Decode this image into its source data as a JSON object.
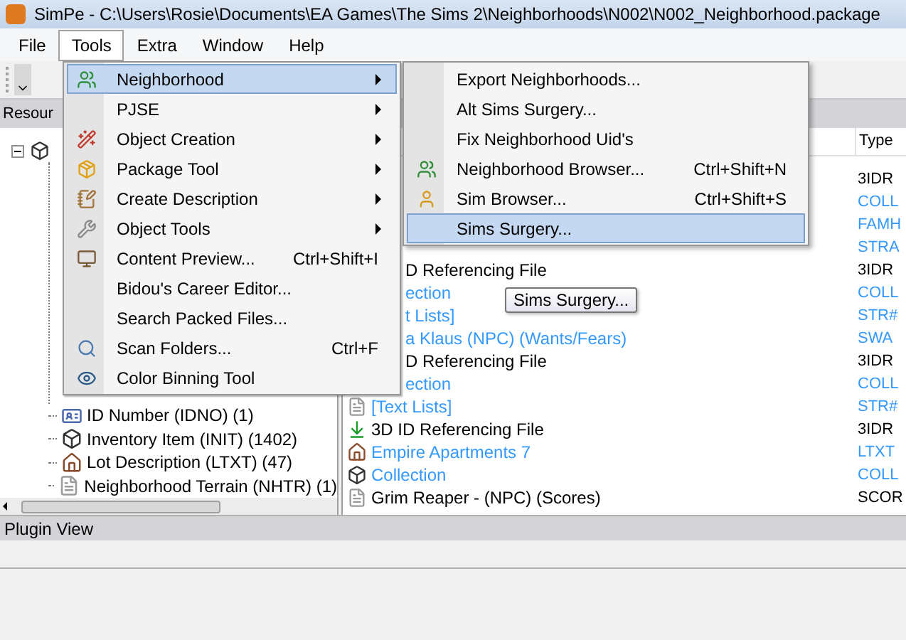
{
  "window": {
    "title": "SimPe - C:\\Users\\Rosie\\Documents\\EA Games\\The Sims 2\\Neighborhoods\\N002\\N002_Neighborhood.package"
  },
  "menu_bar": [
    {
      "label": "File",
      "selected": false
    },
    {
      "label": "Tools",
      "selected": true
    },
    {
      "label": "Extra",
      "selected": false
    },
    {
      "label": "Window",
      "selected": false
    },
    {
      "label": "Help",
      "selected": false
    }
  ],
  "resource_tree": {
    "header": "Resour",
    "root": {
      "expanded": true,
      "children": [
        {
          "label": "ID Number (IDNO) (1)",
          "kind": "id"
        },
        {
          "label": "Inventory Item (INIT) (1402)",
          "kind": "cube"
        },
        {
          "label": "Lot Description (LTXT) (47)",
          "kind": "house"
        },
        {
          "label": "Neighborhood Terrain (NHTR) (1)",
          "kind": "file"
        }
      ]
    }
  },
  "resource_list": {
    "columns": [
      "Type"
    ],
    "rows": [
      {
        "type": "3IDR",
        "color": "#000000"
      },
      {
        "type": "COLL",
        "color": "#3399ff"
      },
      {
        "type": "FAMH",
        "color": "#3399ff"
      },
      {
        "type": "STRA",
        "color": "#3399ff"
      },
      {
        "name": "D Referencing File",
        "type": "3IDR",
        "color": "#000000"
      },
      {
        "name": "ection",
        "type": "COLL",
        "color": "#3399ff"
      },
      {
        "name": "t Lists]",
        "type": "STR#",
        "color": "#3399ff"
      },
      {
        "name": "a Klaus (NPC) (Wants/Fears)",
        "type": "SWA",
        "color": "#3399ff"
      },
      {
        "name": "D Referencing File",
        "type": "3IDR",
        "color": "#000000"
      },
      {
        "name": "ection",
        "type": "COLL",
        "color": "#3399ff"
      },
      {
        "name": "[Text Lists]",
        "type": "STR#",
        "color": "#3399ff",
        "kind": "file"
      },
      {
        "name": "3D ID Referencing File",
        "type": "3IDR",
        "color": "#000000",
        "kind": "arrow"
      },
      {
        "name": "Empire Apartments 7",
        "type": "LTXT",
        "color": "#3399ff",
        "kind": "house"
      },
      {
        "name": "Collection",
        "type": "COLL",
        "color": "#3399ff",
        "kind": "cube"
      },
      {
        "name": "Grim Reaper - (NPC) (Scores)",
        "type": "SCOR",
        "color": "#000000",
        "kind": "file"
      }
    ]
  },
  "tools_menu": {
    "items": [
      {
        "label": "Neighborhood",
        "kind": "people",
        "submenu": true,
        "selected": true
      },
      {
        "label": "PJSE",
        "submenu": true,
        "selected": false
      },
      {
        "label": "Object Creation",
        "kind": "wand",
        "submenu": true,
        "selected": false
      },
      {
        "label": "Package Tool",
        "kind": "package",
        "submenu": true,
        "selected": false
      },
      {
        "label": "Create Description",
        "kind": "note",
        "submenu": true,
        "selected": false
      },
      {
        "label": "Object Tools",
        "kind": "wrench",
        "submenu": true,
        "selected": false
      },
      {
        "label": "Content Preview...",
        "shortcut": "Ctrl+Shift+I",
        "kind": "preview",
        "selected": false
      },
      {
        "label": "Bidou's Career Editor...",
        "selected": false
      },
      {
        "label": "Search Packed Files...",
        "selected": false
      },
      {
        "label": "Scan Folders...",
        "shortcut": "Ctrl+F",
        "kind": "search",
        "selected": false
      },
      {
        "label": "Color Binning Tool",
        "kind": "eye",
        "selected": false
      }
    ]
  },
  "neighborhood_submenu": {
    "items": [
      {
        "label": "Export Neighborhoods...",
        "selected": false
      },
      {
        "label": "Alt Sims Surgery...",
        "selected": false
      },
      {
        "label": "Fix Neighborhood Uid's",
        "selected": false
      },
      {
        "label": "Neighborhood Browser...",
        "shortcut": "Ctrl+Shift+N",
        "kind": "people",
        "selected": false
      },
      {
        "label": "Sim Browser...",
        "shortcut": "Ctrl+Shift+S",
        "kind": "person",
        "selected": false
      },
      {
        "label": "Sims Surgery...",
        "selected": true
      }
    ]
  },
  "tooltip": "Sims Surgery...",
  "plugin_view": {
    "title": "Plugin View"
  }
}
